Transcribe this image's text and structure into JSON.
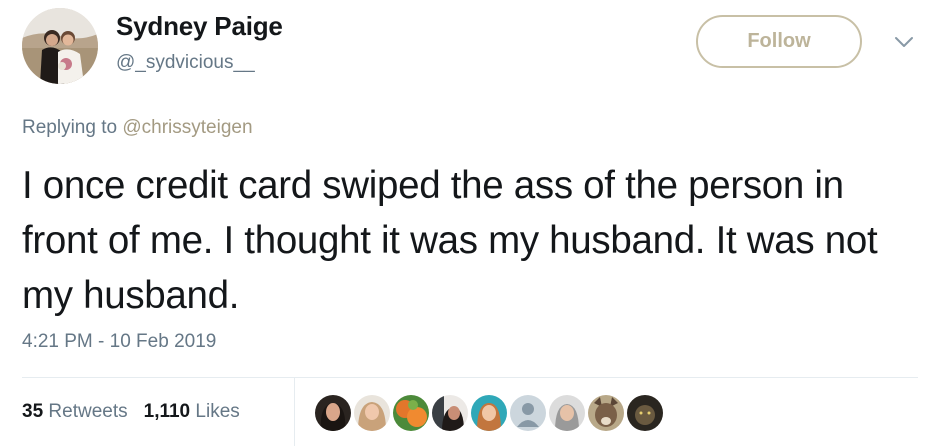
{
  "user": {
    "display_name": "Sydney Paige",
    "handle": "@_sydvicious__",
    "avatar_icon": "profile-photo-icon"
  },
  "follow_label": "Follow",
  "reply": {
    "prefix": "Replying to",
    "mention": "@chrissyteigen"
  },
  "tweet": {
    "text": "I once credit card swiped the ass of the person in front of me. I thought it was my husband. It was not my husband.",
    "timestamp": "4:21 PM - 10 Feb 2019"
  },
  "stats": {
    "retweets_count": "35",
    "retweets_label": "Retweets",
    "likes_count": "1,110",
    "likes_label": "Likes"
  },
  "liker_avatars": [
    "liker-1",
    "liker-2",
    "liker-3",
    "liker-4",
    "liker-5",
    "liker-6",
    "liker-7",
    "liker-8",
    "liker-9"
  ],
  "colors": {
    "follow_border": "#c8c0a6",
    "follow_text": "#bdb49a",
    "mention": "#a39a82",
    "secondary_text": "#657786"
  }
}
